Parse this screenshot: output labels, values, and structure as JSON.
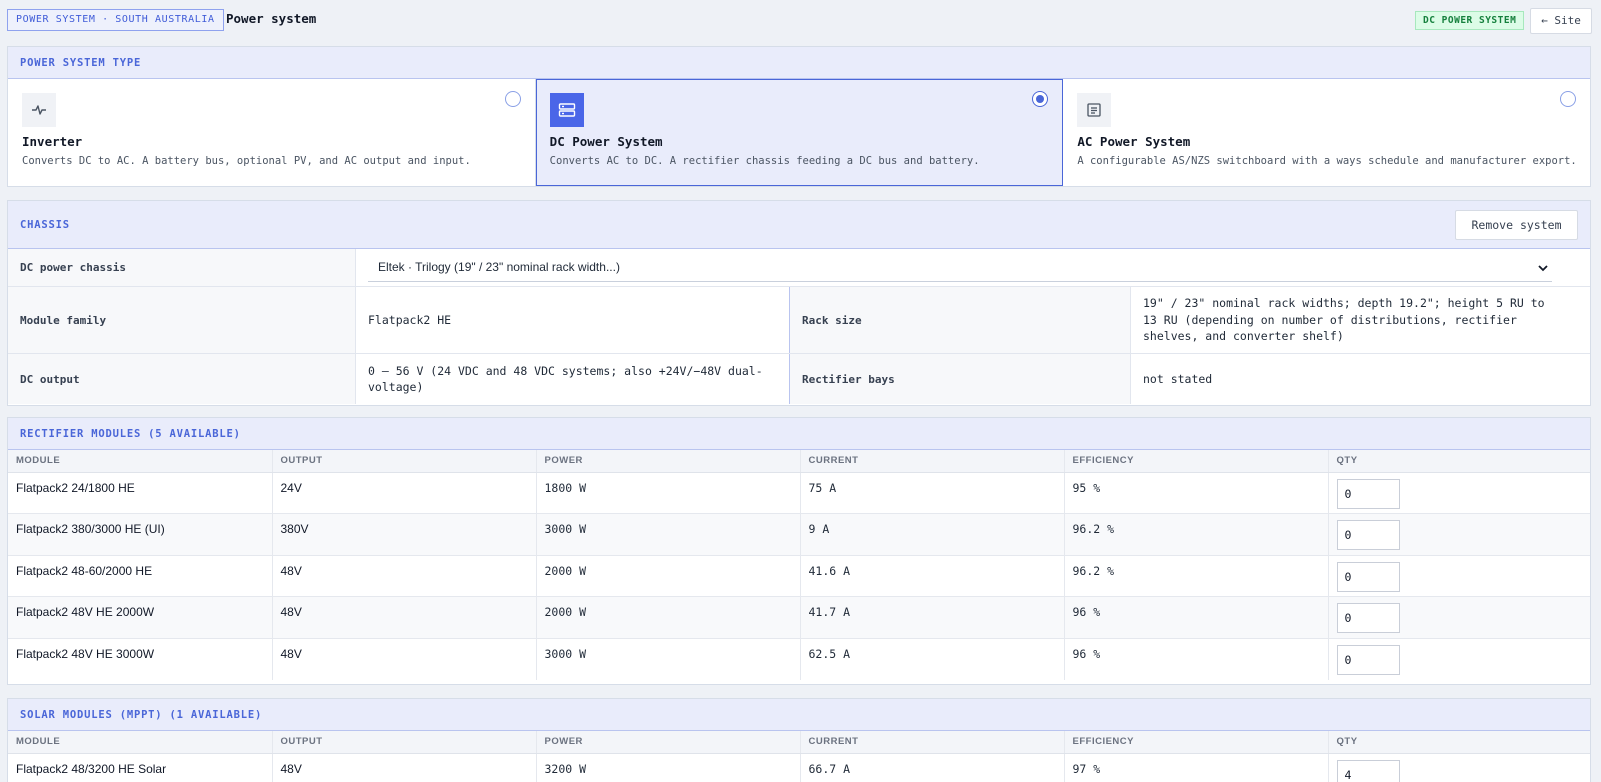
{
  "header": {
    "breadcrumb": "POWER SYSTEM · SOUTH AUSTRALIA",
    "title": "Power system",
    "status_badge": "DC POWER SYSTEM",
    "site_button": "← Site"
  },
  "system_type": {
    "section_title": "POWER SYSTEM TYPE",
    "options": [
      {
        "title": "Inverter",
        "description": "Converts DC to AC. A battery bus, optional PV, and AC output and input.",
        "icon": "pulse-icon",
        "selected": false
      },
      {
        "title": "DC Power System",
        "description": "Converts AC to DC. A rectifier chassis feeding a DC bus and battery.",
        "icon": "server-rack-icon",
        "selected": true
      },
      {
        "title": "AC Power System",
        "description": "A configurable AS/NZS switchboard with a ways schedule and manufacturer export.",
        "icon": "switchboard-icon",
        "selected": false
      }
    ]
  },
  "chassis": {
    "section_title": "CHASSIS",
    "remove_button": "Remove system",
    "dc_power_chassis_label": "DC power chassis",
    "dc_power_chassis_value": "Eltek · Trilogy (19\" / 23\" nominal rack width...)",
    "module_family_label": "Module family",
    "module_family_value": "Flatpack2 HE",
    "rack_size_label": "Rack size",
    "rack_size_value": "19\" / 23\" nominal rack widths; depth 19.2\"; height 5 RU to 13 RU (depending on number of distributions, rectifier shelves, and converter shelf)",
    "dc_output_label": "DC output",
    "dc_output_value": "0 – 56 V (24 VDC and 48 VDC systems; also +24V/−48V dual-voltage)",
    "rectifier_bays_label": "Rectifier bays",
    "rectifier_bays_value": "not stated"
  },
  "rectifier_modules": {
    "section_title": "RECTIFIER MODULES (5 AVAILABLE)",
    "columns": [
      "MODULE",
      "OUTPUT",
      "POWER",
      "CURRENT",
      "EFFICIENCY",
      "QTY"
    ],
    "rows": [
      {
        "module": "Flatpack2 24/1800 HE",
        "output": "24V",
        "power": "1800 W",
        "current": "75 A",
        "efficiency": "95 %",
        "qty": "0"
      },
      {
        "module": "Flatpack2 380/3000 HE (UI)",
        "output": "380V",
        "power": "3000 W",
        "current": "9 A",
        "efficiency": "96.2 %",
        "qty": "0"
      },
      {
        "module": "Flatpack2 48-60/2000 HE",
        "output": "48V",
        "power": "2000 W",
        "current": "41.6 A",
        "efficiency": "96.2 %",
        "qty": "0"
      },
      {
        "module": "Flatpack2 48V HE 2000W",
        "output": "48V",
        "power": "2000 W",
        "current": "41.7 A",
        "efficiency": "96 %",
        "qty": "0"
      },
      {
        "module": "Flatpack2 48V HE 3000W",
        "output": "48V",
        "power": "3000 W",
        "current": "62.5 A",
        "efficiency": "96 %",
        "qty": "0"
      }
    ]
  },
  "solar_modules": {
    "section_title": "SOLAR MODULES (MPPT) (1 AVAILABLE)",
    "columns": [
      "MODULE",
      "OUTPUT",
      "POWER",
      "CURRENT",
      "EFFICIENCY",
      "QTY"
    ],
    "rows": [
      {
        "module": "Flatpack2 48/3200 HE Solar",
        "output": "48V",
        "power": "3200 W",
        "current": "66.7 A",
        "efficiency": "97 %",
        "qty": "4"
      }
    ]
  }
}
